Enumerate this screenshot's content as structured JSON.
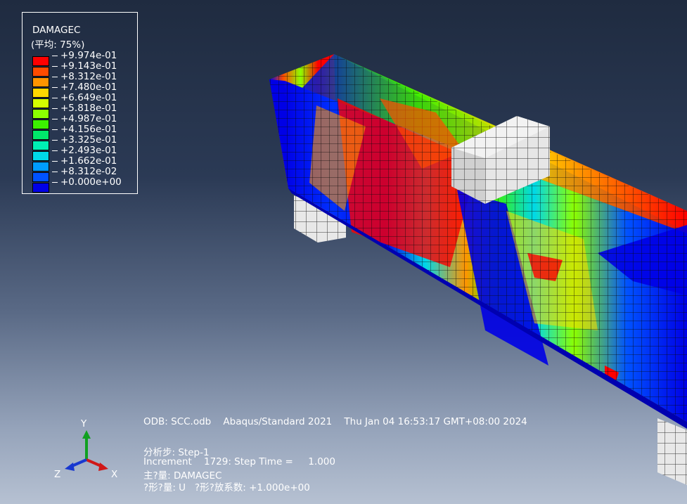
{
  "legend": {
    "title": "DAMAGEC",
    "subtitle": "(平均: 75%)",
    "entries": [
      {
        "label": "+9.974e-01",
        "color": "#ff0000"
      },
      {
        "label": "+9.143e-01",
        "color": "#ff4b00"
      },
      {
        "label": "+8.312e-01",
        "color": "#ff9400"
      },
      {
        "label": "+7.480e-01",
        "color": "#ffd700"
      },
      {
        "label": "+6.649e-01",
        "color": "#d4ff00"
      },
      {
        "label": "+5.818e-01",
        "color": "#8cff00"
      },
      {
        "label": "+4.987e-01",
        "color": "#3cf000"
      },
      {
        "label": "+4.156e-01",
        "color": "#00e86a"
      },
      {
        "label": "+3.325e-01",
        "color": "#00f0b4"
      },
      {
        "label": "+2.493e-01",
        "color": "#00d8e8"
      },
      {
        "label": "+1.662e-01",
        "color": "#009cff"
      },
      {
        "label": "+8.312e-02",
        "color": "#0052ff"
      },
      {
        "label": "+0.000e+00",
        "color": "#0000e6"
      }
    ]
  },
  "info": {
    "odb_line": "ODB: SCC.odb    Abaqus/Standard 2021    Thu Jan 04 16:53:17 GMT+08:00 2024",
    "step_line": "分析步: Step-1",
    "increment_line": "Increment    1729: Step Time =     1.000",
    "primary_var_line": "主?量: DAMAGEC",
    "deformed_var_line": "?形?量: U   ?形?放系数: +1.000e+00"
  },
  "triad": {
    "x_label": "X",
    "y_label": "Y",
    "z_label": "Z",
    "x_color": "#d01818",
    "y_color": "#10a020",
    "z_color": "#1838d0"
  }
}
